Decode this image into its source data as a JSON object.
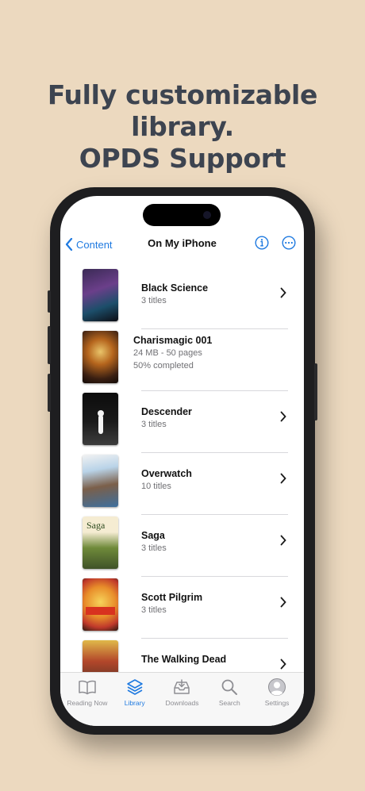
{
  "headline": {
    "line1": "Fully customizable library.",
    "line2": "OPDS Support"
  },
  "navbar": {
    "back_label": "Content",
    "title": "On My iPhone",
    "info_icon": "info-circle-icon",
    "more_icon": "ellipsis-circle-icon"
  },
  "items": [
    {
      "title": "Black Science",
      "subtitle": "3 titles",
      "subtitle2": ""
    },
    {
      "title": "Charismagic 001",
      "subtitle": "24 MB - 50 pages",
      "subtitle2": "50% completed"
    },
    {
      "title": "Descender",
      "subtitle": "3 titles",
      "subtitle2": ""
    },
    {
      "title": "Overwatch",
      "subtitle": "10 titles",
      "subtitle2": ""
    },
    {
      "title": "Saga",
      "subtitle": "3 titles",
      "subtitle2": ""
    },
    {
      "title": "Scott Pilgrim",
      "subtitle": "3 titles",
      "subtitle2": ""
    },
    {
      "title": "The Walking Dead",
      "subtitle": "",
      "subtitle2": ""
    }
  ],
  "tabs": [
    {
      "label": "Reading Now",
      "icon": "book-open-icon",
      "active": false
    },
    {
      "label": "Library",
      "icon": "stack-icon",
      "active": true
    },
    {
      "label": "Downloads",
      "icon": "tray-download-icon",
      "active": false
    },
    {
      "label": "Search",
      "icon": "magnifier-icon",
      "active": false
    },
    {
      "label": "Settings",
      "icon": "person-circle-icon",
      "active": false
    }
  ],
  "colors": {
    "background": "#ecd9bf",
    "accent": "#1f7ae0",
    "headline": "#3d4450"
  }
}
